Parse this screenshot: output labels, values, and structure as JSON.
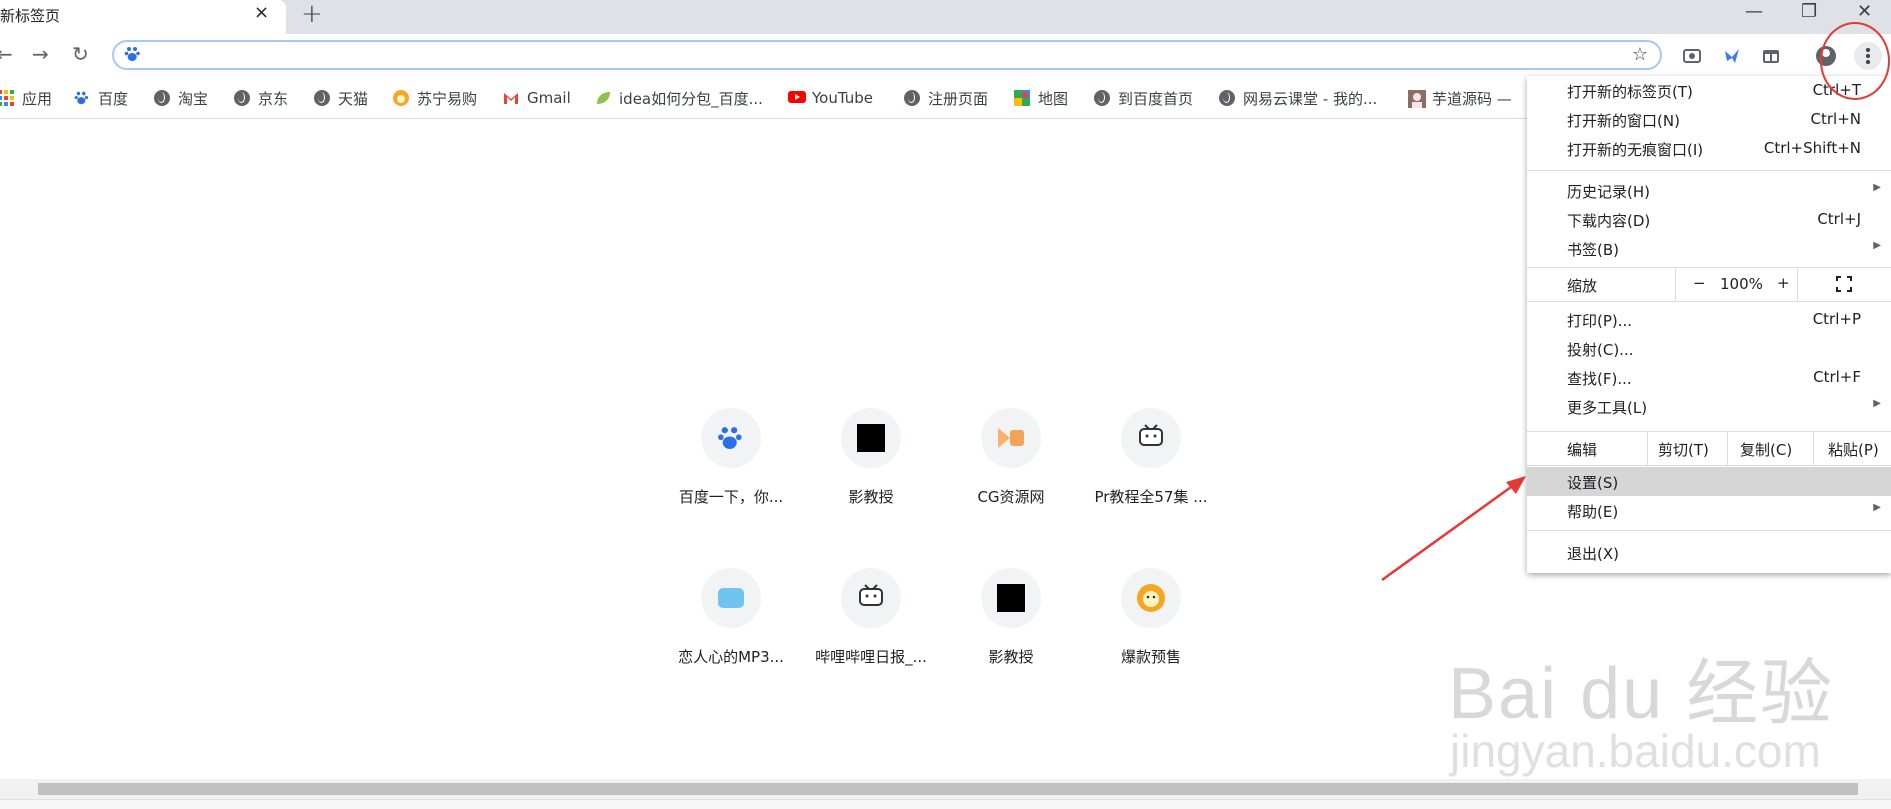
{
  "tab": {
    "title": "新标签页",
    "close": "×",
    "new_tab": "+"
  },
  "window": {
    "minimize": "—",
    "restore": "❐",
    "close": "✕"
  },
  "toolbar": {
    "back": "←",
    "forward": "→",
    "reload": "↻",
    "bookmark_star": "☆"
  },
  "bookmarks": [
    {
      "label": "应用",
      "icon": "apps-grid-icon"
    },
    {
      "label": "百度",
      "icon": "baidu-paw-icon"
    },
    {
      "label": "淘宝",
      "icon": "globe-icon"
    },
    {
      "label": "京东",
      "icon": "globe-icon"
    },
    {
      "label": "天猫",
      "icon": "globe-icon"
    },
    {
      "label": "苏宁易购",
      "icon": "suning-lion-icon"
    },
    {
      "label": "Gmail",
      "icon": "gmail-icon"
    },
    {
      "label": "idea如何分包_百度...",
      "icon": "leaf-icon"
    },
    {
      "label": "YouTube",
      "icon": "youtube-icon"
    },
    {
      "label": "注册页面",
      "icon": "globe-icon"
    },
    {
      "label": "地图",
      "icon": "maps-icon"
    },
    {
      "label": "到百度首页",
      "icon": "globe-icon"
    },
    {
      "label": "网易云课堂 - 我的...",
      "icon": "globe-icon"
    },
    {
      "label": "芋道源码 —",
      "icon": "avatar-icon"
    }
  ],
  "shortcuts": [
    {
      "label": "百度一下，你...",
      "icon": "baidu-paw-icon"
    },
    {
      "label": "影教授",
      "icon": "yingjiaoshou-icon"
    },
    {
      "label": "CG资源网",
      "icon": "cg-icon"
    },
    {
      "label": "Pr教程全57集 ...",
      "icon": "bilibili-tv-icon"
    },
    {
      "label": "恋人心的MP3...",
      "icon": "mp3-icon"
    },
    {
      "label": "哔哩哔哩日报_...",
      "icon": "bilibili-tv-icon"
    },
    {
      "label": "影教授",
      "icon": "yingjiaoshou-icon"
    },
    {
      "label": "爆款预售",
      "icon": "suning-lion-icon"
    }
  ],
  "menu": {
    "new_tab": {
      "label": "打开新的标签页(T)",
      "shortcut": "Ctrl+T"
    },
    "new_window": {
      "label": "打开新的窗口(N)",
      "shortcut": "Ctrl+N"
    },
    "incognito": {
      "label": "打开新的无痕窗口(I)",
      "shortcut": "Ctrl+Shift+N"
    },
    "history": {
      "label": "历史记录(H)"
    },
    "downloads": {
      "label": "下载内容(D)",
      "shortcut": "Ctrl+J"
    },
    "bookmarks": {
      "label": "书签(B)"
    },
    "zoom": {
      "label": "缩放",
      "minus": "−",
      "value": "100%",
      "plus": "+"
    },
    "print": {
      "label": "打印(P)...",
      "shortcut": "Ctrl+P"
    },
    "cast": {
      "label": "投射(C)..."
    },
    "find": {
      "label": "查找(F)...",
      "shortcut": "Ctrl+F"
    },
    "more_tools": {
      "label": "更多工具(L)"
    },
    "edit": {
      "label": "编辑",
      "cut": "剪切(T)",
      "copy": "复制(C)",
      "paste": "粘贴(P)"
    },
    "settings": {
      "label": "设置(S)"
    },
    "help": {
      "label": "帮助(E)"
    },
    "exit": {
      "label": "退出(X)"
    },
    "submenu_arrow": "▶"
  },
  "watermark": {
    "big": "Bai du 经验",
    "small": "jingyan.baidu.com"
  },
  "colors": {
    "annotation_red": "#e53935",
    "highlight": "#d6d6d6"
  }
}
